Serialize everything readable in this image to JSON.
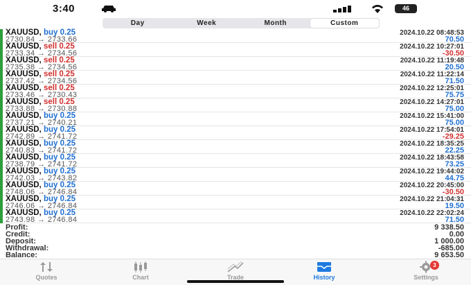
{
  "status_bar": {
    "time": "3:40",
    "battery": "46"
  },
  "tabs_segment": [
    {
      "label": "Day",
      "active": false
    },
    {
      "label": "Week",
      "active": false
    },
    {
      "label": "Month",
      "active": false
    },
    {
      "label": "Custom",
      "active": true
    }
  ],
  "colors": {
    "buy": "#1f6fd1",
    "sell": "#d32f2f",
    "profit": "#1f6fd1",
    "loss": "#d32f2f",
    "accent_bar": "#2e9e3a"
  },
  "trades": [
    {
      "symbol": "XAUUSD,",
      "side": "buy",
      "volume": "0.25",
      "prices": "2730.84 → 2733.66",
      "time": "2024.10.22 08:48:53",
      "pl": "70.50",
      "positive": true
    },
    {
      "symbol": "XAUUSD,",
      "side": "sell",
      "volume": "0.25",
      "prices": "2733.34 → 2734.56",
      "time": "2024.10.22 10:27:01",
      "pl": "-30.50",
      "positive": false
    },
    {
      "symbol": "XAUUSD,",
      "side": "sell",
      "volume": "0.25",
      "prices": "2735.38 → 2734.56",
      "time": "2024.10.22 11:19:48",
      "pl": "20.50",
      "positive": true
    },
    {
      "symbol": "XAUUSD,",
      "side": "sell",
      "volume": "0.25",
      "prices": "2737.42 → 2734.56",
      "time": "2024.10.22 11:22:14",
      "pl": "71.50",
      "positive": true
    },
    {
      "symbol": "XAUUSD,",
      "side": "sell",
      "volume": "0.25",
      "prices": "2733.46 → 2730.43",
      "time": "2024.10.22 12:25:01",
      "pl": "75.75",
      "positive": true
    },
    {
      "symbol": "XAUUSD,",
      "side": "sell",
      "volume": "0.25",
      "prices": "2733.88 → 2730.88",
      "time": "2024.10.22 14:27:01",
      "pl": "75.00",
      "positive": true
    },
    {
      "symbol": "XAUUSD,",
      "side": "buy",
      "volume": "0.25",
      "prices": "2737.21 → 2740.21",
      "time": "2024.10.22 15:41:00",
      "pl": "75.00",
      "positive": true
    },
    {
      "symbol": "XAUUSD,",
      "side": "buy",
      "volume": "0.25",
      "prices": "2742.89 → 2741.72",
      "time": "2024.10.22 17:54:01",
      "pl": "-29.25",
      "positive": false
    },
    {
      "symbol": "XAUUSD,",
      "side": "buy",
      "volume": "0.25",
      "prices": "2740.83 → 2741.72",
      "time": "2024.10.22 18:35:25",
      "pl": "22.25",
      "positive": true
    },
    {
      "symbol": "XAUUSD,",
      "side": "buy",
      "volume": "0.25",
      "prices": "2738.79 → 2741.72",
      "time": "2024.10.22 18:43:58",
      "pl": "73.25",
      "positive": true
    },
    {
      "symbol": "XAUUSD,",
      "side": "buy",
      "volume": "0.25",
      "prices": "2742.03 → 2743.82",
      "time": "2024.10.22 19:44:02",
      "pl": "44.75",
      "positive": true
    },
    {
      "symbol": "XAUUSD,",
      "side": "buy",
      "volume": "0.25",
      "prices": "2748.06 → 2746.84",
      "time": "2024.10.22 20:45:00",
      "pl": "-30.50",
      "positive": false
    },
    {
      "symbol": "XAUUSD,",
      "side": "buy",
      "volume": "0.25",
      "prices": "2746.06 → 2746.84",
      "time": "2024.10.22 21:04:31",
      "pl": "19.50",
      "positive": true
    },
    {
      "symbol": "XAUUSD,",
      "side": "buy",
      "volume": "0.25",
      "prices": "2743.98 → 2746.84",
      "time": "2024.10.22 22:02:24",
      "pl": "71.50",
      "positive": true
    }
  ],
  "summary": [
    {
      "label": "Profit:",
      "value": "9 338.50"
    },
    {
      "label": "Credit:",
      "value": "0.00"
    },
    {
      "label": "Deposit:",
      "value": "1 000.00"
    },
    {
      "label": "Withdrawal:",
      "value": "-685.00"
    },
    {
      "label": "Balance:",
      "value": "9 653.50"
    }
  ],
  "tabbar": [
    {
      "label": "Quotes",
      "icon": "quotes-icon",
      "active": false
    },
    {
      "label": "Chart",
      "icon": "chart-icon",
      "active": false
    },
    {
      "label": "Trade",
      "icon": "trade-icon",
      "active": false
    },
    {
      "label": "History",
      "icon": "history-icon",
      "active": true
    },
    {
      "label": "Settings",
      "icon": "gear-icon",
      "active": false,
      "badge": "3"
    }
  ]
}
